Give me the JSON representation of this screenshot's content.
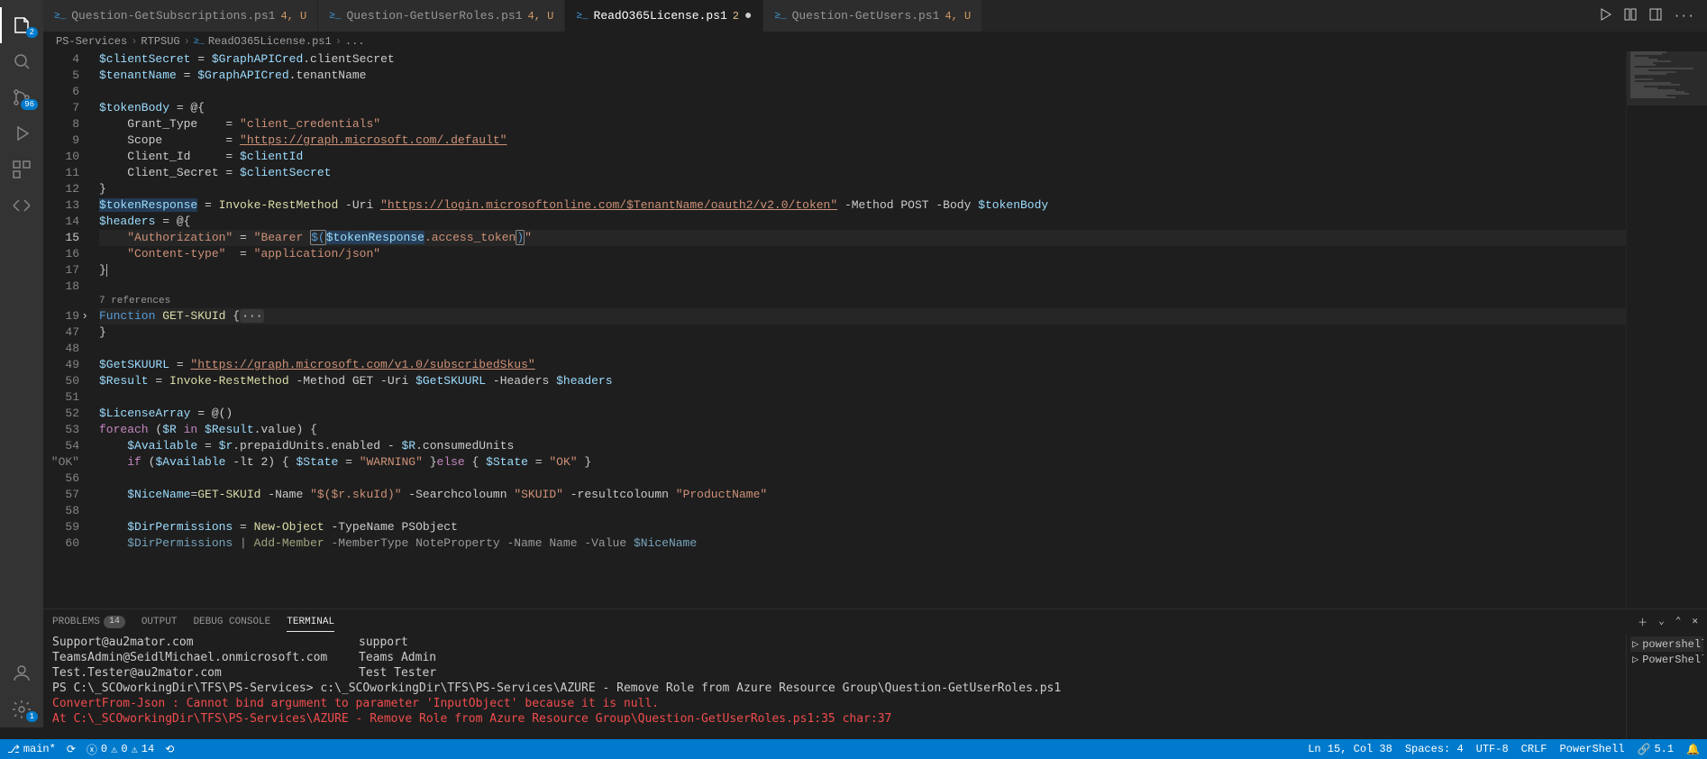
{
  "tabs": [
    {
      "label": "Question-GetSubscriptions.ps1",
      "git": "4, U",
      "active": false,
      "dirty": false
    },
    {
      "label": "Question-GetUserRoles.ps1",
      "git": "4, U",
      "active": false,
      "dirty": false
    },
    {
      "label": "ReadO365License.ps1",
      "git": "2",
      "active": true,
      "dirty": true
    },
    {
      "label": "Question-GetUsers.ps1",
      "git": "4, U",
      "active": false,
      "dirty": false
    }
  ],
  "breadcrumb": {
    "seg1": "PS-Services",
    "seg2": "RTPSUG",
    "seg3": "ReadO365License.ps1",
    "seg4": "..."
  },
  "activity": {
    "explorer_badge": "2",
    "scm_badge": "96",
    "settings_badge": "1"
  },
  "code": {
    "l4": {
      "n": "4",
      "a": "$clientSecret",
      "b": " = ",
      "c": "$GraphAPICred",
      "d": ".clientSecret"
    },
    "l5": {
      "n": "5",
      "a": "$tenantName",
      "b": " = ",
      "c": "$GraphAPICred",
      "d": ".tenantName"
    },
    "l6": {
      "n": "6",
      "a": ""
    },
    "l7": {
      "n": "7",
      "a": "$tokenBody",
      "b": " = @{"
    },
    "l8": {
      "n": "8",
      "a": "    Grant_Type    = ",
      "b": "\"client_credentials\""
    },
    "l9": {
      "n": "9",
      "a": "    Scope         = ",
      "b": "\"https://graph.microsoft.com/.default\""
    },
    "l10": {
      "n": "10",
      "a": "    Client_Id     = ",
      "b": "$clientId"
    },
    "l11": {
      "n": "11",
      "a": "    Client_Secret = ",
      "b": "$clientSecret"
    },
    "l12": {
      "n": "12",
      "a": "}"
    },
    "l13": {
      "n": "13",
      "a": "$tokenResponse",
      "b": " = ",
      "c": "Invoke-RestMethod",
      "d": " -Uri ",
      "e": "\"https://login.microsoftonline.com/$TenantName/oauth2/v2.0/token\"",
      "f": " -Method POST -Body ",
      "g": "$tokenBody"
    },
    "l14": {
      "n": "14",
      "a": "$headers",
      "b": " = @{"
    },
    "l15": {
      "n": "15",
      "a": "    ",
      "b": "\"Authorization\"",
      "c": " = ",
      "d": "\"Bearer ",
      "e": "$(",
      "f": "$tokenResponse",
      "g": ".access_token",
      "h": ")",
      "i": "\""
    },
    "l16": {
      "n": "16",
      "a": "    ",
      "b": "\"Content-type\"",
      "c": "  = ",
      "d": "\"application/json\""
    },
    "l17": {
      "n": "17",
      "a": "}"
    },
    "l18": {
      "n": "18",
      "a": ""
    },
    "codelens": "7 references",
    "l19": {
      "n": "19",
      "a": "Function",
      "b": " GET-SKUId ",
      "c": "{",
      "d": "···"
    },
    "l47": {
      "n": "47",
      "a": "}"
    },
    "l48": {
      "n": "48",
      "a": ""
    },
    "l49": {
      "n": "49",
      "a": "$GetSKUURL",
      "b": " = ",
      "c": "\"https://graph.microsoft.com/v1.0/subscribedSkus\""
    },
    "l50": {
      "n": "50",
      "a": "$Result",
      "b": " = ",
      "c": "Invoke-RestMethod",
      "d": " -Method GET -Uri ",
      "e": "$GetSKUURL",
      "f": " -Headers ",
      "g": "$headers"
    },
    "l51": {
      "n": "51",
      "a": ""
    },
    "l52": {
      "n": "52",
      "a": "$LicenseArray",
      "b": " = @()"
    },
    "l53": {
      "n": "53",
      "a": "foreach",
      "b": " (",
      "c": "$R",
      "d": " in ",
      "e": "$Result",
      "f": ".value) {"
    },
    "l54": {
      "n": "54",
      "a": "    ",
      "b": "$Available",
      "c": " = ",
      "d": "$r",
      "e": ".prepaidUnits.enabled - ",
      "f": "$R",
      "g": ".consumedUnits"
    },
    "l55": {
      "n": "\"OK\"",
      "a": "    ",
      "b": "if",
      "c": " (",
      "d": "$Available",
      "e": " -lt 2) { ",
      "f": "$State",
      "g": " = ",
      "h": "\"WARNING\"",
      "i": " }",
      "j": "else",
      "k": " { ",
      "l": "$State",
      "m": " = ",
      "o": " }"
    },
    "l56": {
      "n": "56",
      "a": ""
    },
    "l57": {
      "n": "57",
      "a": "    ",
      "b": "$NiceName",
      "c": "=",
      "d": "GET-SKUId",
      "e": " -Name ",
      "f": "\"$($r.skuId)\"",
      "g": " -Searchcoloumn ",
      "h": "\"SKUID\"",
      "i": " -resultcoloumn ",
      "j": "\"ProductName\""
    },
    "l58": {
      "n": "58",
      "a": ""
    },
    "l59": {
      "n": "59",
      "a": "    ",
      "b": "$DirPermissions",
      "c": " = ",
      "d": "New-Object",
      "e": " -TypeName PSObject"
    },
    "l60": {
      "n": "60",
      "a": "    ",
      "b": "$DirPermissions",
      "c": " | ",
      "d": "Add-Member",
      "e": " -MemberType NoteProperty -Name Name -Value ",
      "f": "$NiceName"
    }
  },
  "panel": {
    "tab_problems": "PROBLEMS",
    "problems_badge": "14",
    "tab_output": "OUTPUT",
    "tab_debug": "DEBUG CONSOLE",
    "tab_terminal": "TERMINAL",
    "rows": [
      {
        "c1": "Support@au2mator.com",
        "c2": "support"
      },
      {
        "c1": "TeamsAdmin@SeidlMichael.onmicrosoft.com",
        "c2": "Teams Admin"
      },
      {
        "c1": "Test.Tester@au2mator.com",
        "c2": "Test Tester"
      }
    ],
    "blank": "",
    "prompt": "PS C:\\_SCOworkingDir\\TFS\\PS-Services> c:\\_SCOworkingDir\\TFS\\PS-Services\\AZURE - Remove Role from Azure Resource Group\\Question-GetUserRoles.ps1",
    "err1": "ConvertFrom-Json : Cannot bind argument to parameter 'InputObject' because it is null.",
    "err2": "At C:\\_SCOworkingDir\\TFS\\PS-Services\\AZURE - Remove Role from Azure Resource Group\\Question-GetUserRoles.ps1:35 char:37",
    "term_list": [
      {
        "label": "powershell",
        "active": true
      },
      {
        "label": "PowerShell I...",
        "active": false
      }
    ]
  },
  "status": {
    "branch": "main*",
    "sync": "⟳",
    "errors": "0",
    "warnings": "0",
    "info": "14",
    "cursor": "Ln 15, Col 38",
    "spaces": "Spaces: 4",
    "encoding": "UTF-8",
    "eol": "CRLF",
    "language": "PowerShell",
    "ps_ver": "5.1",
    "notif": ""
  }
}
